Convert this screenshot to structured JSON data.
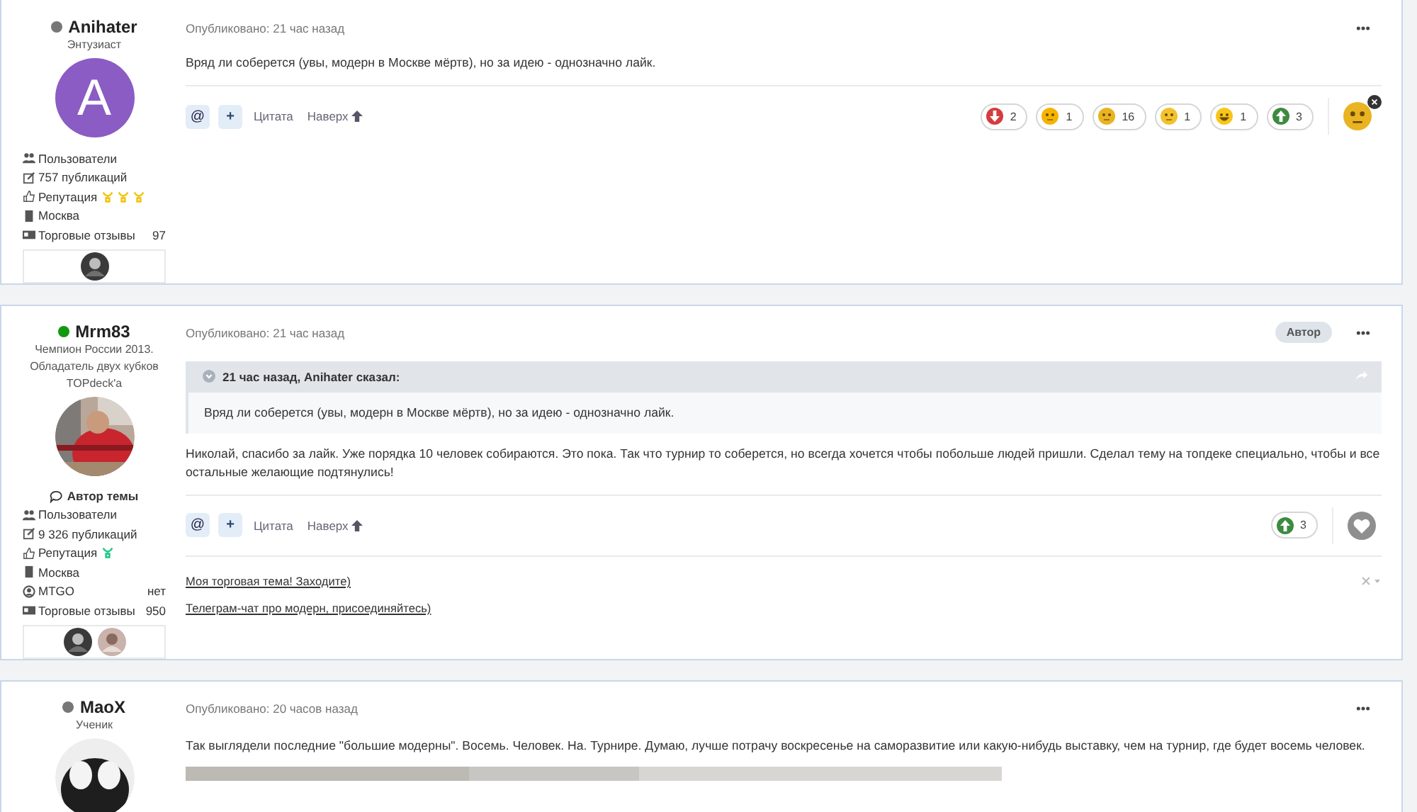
{
  "posts": [
    {
      "author": {
        "name": "Anihater",
        "online": false,
        "titles": [
          "Энтузиаст"
        ],
        "avatar": {
          "kind": "letter",
          "letter": "A"
        },
        "stats": [
          {
            "kind": "group",
            "label": "Пользователи"
          },
          {
            "kind": "posts",
            "label": "757 публикаций"
          },
          {
            "kind": "reputation",
            "label": "Репутация",
            "marks": [
              {
                "color": "#f2c40f"
              },
              {
                "color": "#f2c40f"
              },
              {
                "color": "#f2c40f"
              }
            ]
          },
          {
            "kind": "city",
            "label": "Москва"
          },
          {
            "kind": "trade",
            "label": "Торговые отзывы",
            "value": "97"
          }
        ],
        "deals": [
          {
            "kind": "picture"
          }
        ]
      },
      "published": "Опубликовано: 21 час назад",
      "body": [
        "Вряд ли соберется (увы, модерн в Москве мёртв), но за идею - однозначно лайк."
      ],
      "actions": {
        "mention": "@",
        "add": "+",
        "quote": "Цитата",
        "top": "Наверх"
      },
      "reactions": [
        {
          "kind": "down",
          "count": "2"
        },
        {
          "kind": "sleepy",
          "count": "1"
        },
        {
          "kind": "cheers",
          "count": "16"
        },
        {
          "kind": "glasses",
          "count": "1"
        },
        {
          "kind": "laugh",
          "count": "1"
        },
        {
          "kind": "up",
          "count": "3"
        }
      ],
      "reaction_button": {
        "kind": "chosen"
      }
    },
    {
      "author": {
        "name": "Mrm83",
        "online": true,
        "titles": [
          "Чемпион России 2013.",
          "Обладатель двух кубков",
          "TOPdeck'a"
        ],
        "avatar": {
          "kind": "picture"
        },
        "topic_badge": "Автор темы",
        "stats": [
          {
            "kind": "group",
            "label": "Пользователи"
          },
          {
            "kind": "posts",
            "label": "9 326 публикаций"
          },
          {
            "kind": "reputation",
            "label": "Репутация",
            "marks": [
              {
                "color": "#1fc98a"
              }
            ]
          },
          {
            "kind": "city",
            "label": "Москва"
          },
          {
            "kind": "mtgo",
            "label": "MTGO",
            "value": "нет"
          },
          {
            "kind": "trade",
            "label": "Торговые отзывы",
            "value": "950"
          }
        ],
        "deals": [
          {
            "kind": "picture"
          },
          {
            "kind": "picture"
          }
        ]
      },
      "published": "Опубликовано: 21 час назад",
      "author_badge": "Автор",
      "quote": {
        "header": "21 час назад, Anihater сказал:",
        "text": "Вряд ли соберется (увы, модерн в Москве мёртв), но за идею - однозначно лайк."
      },
      "body": [
        "Николай, спасибо за лайк. Уже порядка 10 человек собираются. Это пока. Так что турнир то соберется, но всегда хочется чтобы побольше людей пришли. Сделал тему на топдеке специально, чтобы и все остальные желающие подтянулись!"
      ],
      "actions": {
        "mention": "@",
        "add": "+",
        "quote": "Цитата",
        "top": "Наверх"
      },
      "reactions": [
        {
          "kind": "up",
          "count": "3"
        }
      ],
      "reaction_button": {
        "kind": "like"
      },
      "signature": [
        "Моя торговая тема! Заходите)",
        "Телеграм-чат про модерн, присоединяйтесь)"
      ]
    },
    {
      "author": {
        "name": "MaoX",
        "online": false,
        "titles": [
          "Ученик"
        ],
        "avatar": {
          "kind": "picture"
        }
      },
      "published": "Опубликовано: 20 часов назад",
      "body": [
        "Так выглядели последние \"большие модерны\". Восемь. Человек. На. Турнире. Думаю, лучше потрачу воскресенье на саморазвитие или какую-нибудь выставку, чем на турнир, где будет восемь человек."
      ],
      "image": {
        "kind": "picture"
      }
    }
  ]
}
